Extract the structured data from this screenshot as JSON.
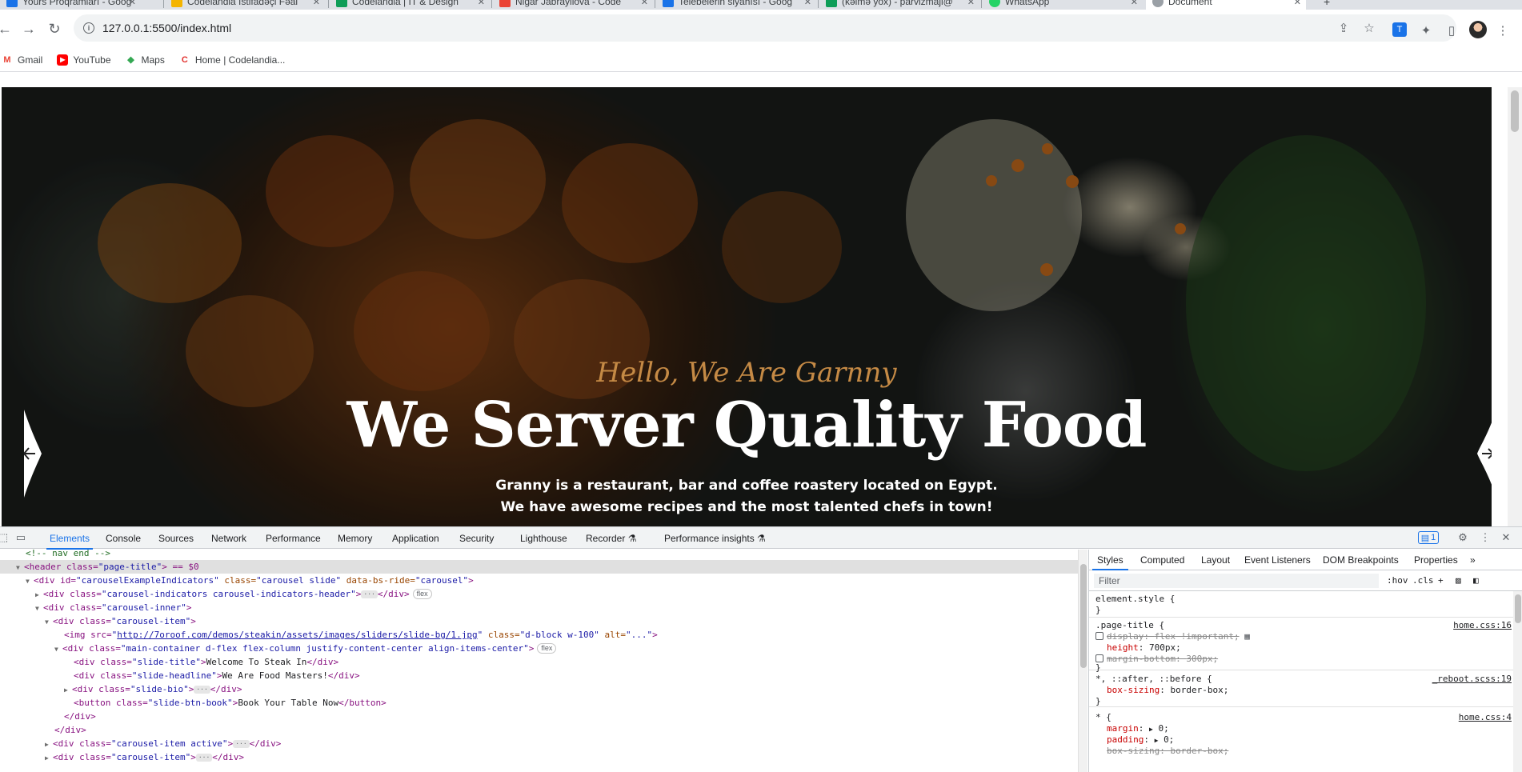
{
  "browser": {
    "tabs": [
      {
        "title": "Yours Proqramları - Goog",
        "color": "#1a73e8"
      },
      {
        "title": "Codelandia İstifadəçi Fəal",
        "color": "#f4b400"
      },
      {
        "title": "Codelandia | IT & Design",
        "color": "#0f9d58"
      },
      {
        "title": "Nigar Jabrayilova - Code",
        "color": "#ea4335"
      },
      {
        "title": "Telebelerin siyahısı - Goog",
        "color": "#1a73e8"
      },
      {
        "title": "(kəlmə yox) - parvizmaji@",
        "color": "#0f9d58"
      },
      {
        "title": "WhatsApp",
        "color": "#25d366"
      },
      {
        "title": "Document",
        "color": "#9aa0a6"
      }
    ],
    "url": "127.0.0.1:5500/index.html",
    "bookmarks": [
      {
        "label": "Gmail",
        "icon": "gmail-icon",
        "color": "#ea4335"
      },
      {
        "label": "YouTube",
        "icon": "youtube-icon",
        "color": "#ff0000"
      },
      {
        "label": "Maps",
        "icon": "maps-icon",
        "color": "#34a853"
      },
      {
        "label": "Home | Codelandia...",
        "icon": "codelandia-icon",
        "color": "#e2302d"
      }
    ]
  },
  "hero": {
    "slide_title": "Hello, We Are Garnny",
    "slide_headline": "We Server Quality Food",
    "slide_bio": "Granny is a restaurant, bar and coffee roastery located on Egypt. We have awesome recipes and the most talented chefs in town!"
  },
  "devtools": {
    "tabs": [
      "Elements",
      "Console",
      "Sources",
      "Network",
      "Performance",
      "Memory",
      "Application",
      "Security",
      "Lighthouse",
      "Recorder ⚗",
      "Performance insights ⚗"
    ],
    "issues_badge": "1",
    "elements": {
      "comment": "<!-- nav end -->",
      "header_tag": "<header class=",
      "header_class": "\"page-title\"",
      "header_tail": "> == $0",
      "lines": [
        {
          "a": "<div id=",
          "b": "\"carouselExampleIndicators\"",
          "c": " class=",
          "d": "\"carousel slide\"",
          "e": " data-bs-ride=",
          "f": "\"carousel\"",
          "g": ">"
        },
        {
          "a": "<div class=",
          "b": "\"carousel-indicators carousel-indicators-header\"",
          "c": ">",
          "d": "</div>",
          "pill": "flex"
        },
        {
          "a": "<div class=",
          "b": "\"carousel-inner\"",
          "c": ">"
        },
        {
          "a": "<div class=",
          "b": "\"carousel-item\"",
          "c": ">"
        }
      ],
      "img": {
        "tag": "<img src=",
        "src": "http://7oroof.com/demos/steakin/assets/images/sliders/slide-bg/1.jpg",
        "cls_attr": " class=",
        "cls": "\"d-block w-100\"",
        "alt_attr": " alt=",
        "alt": "\"...\"",
        "end": ">"
      },
      "main": {
        "a": "<div class=",
        "b": "\"main-container d-flex flex-column justify-content-center align-items-center\"",
        "c": ">",
        "pill": "flex"
      },
      "inner": [
        {
          "open": "<div class=",
          "cls": "\"slide-title\"",
          "text": "Welcome To Steak In",
          "close": "</div>"
        },
        {
          "open": "<div class=",
          "cls": "\"slide-headline\"",
          "text": "We Are Food Masters!",
          "close": "</div>"
        },
        {
          "open": "<div class=",
          "cls": "\"slide-bio\"",
          "text": "",
          "close": "</div>"
        },
        {
          "open": "<button class=",
          "cls": "\"slide-btn-book\"",
          "text": "Book Your Table Now",
          "close": "</button>"
        }
      ],
      "close_div": "</div>",
      "active_item": {
        "a": "<div class=",
        "b": "\"carousel-item active\"",
        "c": ">",
        "d": "</div>"
      },
      "last_item": {
        "a": "<div class=",
        "b": "\"carousel-item\"",
        "c": ">",
        "d": "</div>"
      }
    },
    "styles_panel": {
      "tabs": [
        "Styles",
        "Computed",
        "Layout",
        "Event Listeners",
        "DOM Breakpoints",
        "Properties"
      ],
      "filter_placeholder": "Filter",
      "hov": ":hov",
      "cls": ".cls",
      "element_style": "element.style {",
      "close_brace": "}",
      "page_title_selector": ".page-title {",
      "page_title_src": "home.css:16",
      "display_prop": "display",
      "display_val": "flex !important;",
      "height_prop": "height",
      "height_val": "700px;",
      "margin_bottom_prop": "margin-bottom",
      "margin_bottom_val": "300px;",
      "reboot_selector": "*, ::after, ::before {",
      "reboot_src": "_reboot.scss:19",
      "box_sizing_prop": "box-sizing",
      "box_sizing_val": "border-box;",
      "star_selector": "* {",
      "star_src": "home.css:4",
      "margin_prop": "margin",
      "margin_val": "0;",
      "padding_prop": "padding",
      "padding_val": "0;",
      "box_sizing2_prop": "box-sizing",
      "box_sizing2_val": "border-box;"
    }
  }
}
